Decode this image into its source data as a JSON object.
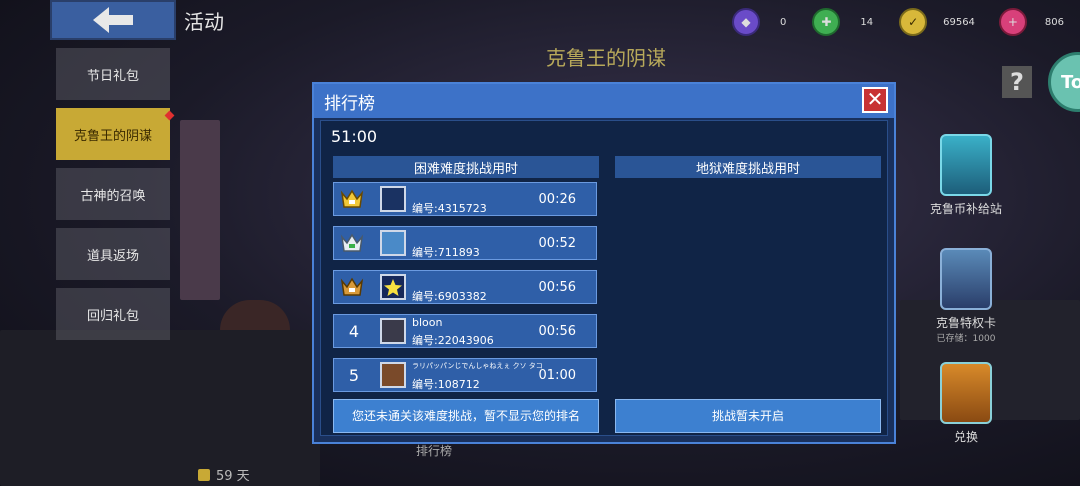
{
  "header": {
    "title": "活动",
    "back_icon": "back-arrow-icon"
  },
  "currency": [
    {
      "icon": "purple-coin-icon",
      "value": "0",
      "color": "#6a4bc8"
    },
    {
      "icon": "green-gem-icon",
      "value": "14",
      "color": "#3fae52"
    },
    {
      "icon": "gold-coin-plus-icon",
      "value": "69564",
      "color": "#d8b83a"
    },
    {
      "icon": "pink-gem-plus-icon",
      "value": "806",
      "color": "#d8407a"
    }
  ],
  "event_title": "克鲁王的阴谋",
  "menu": [
    {
      "label": "节日礼包",
      "active": false
    },
    {
      "label": "克鲁王的阴谋",
      "active": true
    },
    {
      "label": "古神的召唤",
      "active": false
    },
    {
      "label": "道具返场",
      "active": false
    },
    {
      "label": "回归礼包",
      "active": false
    }
  ],
  "days_left": "59 天",
  "rank_button_label": "排行榜",
  "right_panel": {
    "help": "?",
    "top_badge": "To",
    "items": [
      {
        "label": "克鲁币补给站",
        "sub": ""
      },
      {
        "label": "克鲁特权卡",
        "sub": "已存储：1000"
      },
      {
        "label": "兑换",
        "sub": ""
      }
    ]
  },
  "modal": {
    "title": "排行榜",
    "timer": "51:00",
    "left_header": "困难难度挑战用时",
    "right_header": "地狱难度挑战用时",
    "rows": [
      {
        "rank": "",
        "rank_icon": "gold-crown-icon",
        "name": "",
        "id": "编号:4315723",
        "time": "00:26"
      },
      {
        "rank": "",
        "rank_icon": "silver-crown-icon",
        "name": "",
        "id": "编号:711893",
        "time": "00:52"
      },
      {
        "rank": "",
        "rank_icon": "bronze-crown-icon",
        "name": "",
        "id": "编号:6903382",
        "time": "00:56"
      },
      {
        "rank": "4",
        "rank_icon": "",
        "name": "bloon",
        "id": "编号:22043906",
        "time": "00:56"
      },
      {
        "rank": "5",
        "rank_icon": "",
        "name": "ラリパッパンじでんしゃねえぇ クソ タコ",
        "id": "编号:108712",
        "time": "01:00"
      }
    ],
    "left_message": "您还未通关该难度挑战，暂不显示您的排名",
    "right_message": "挑战暂未开启"
  }
}
